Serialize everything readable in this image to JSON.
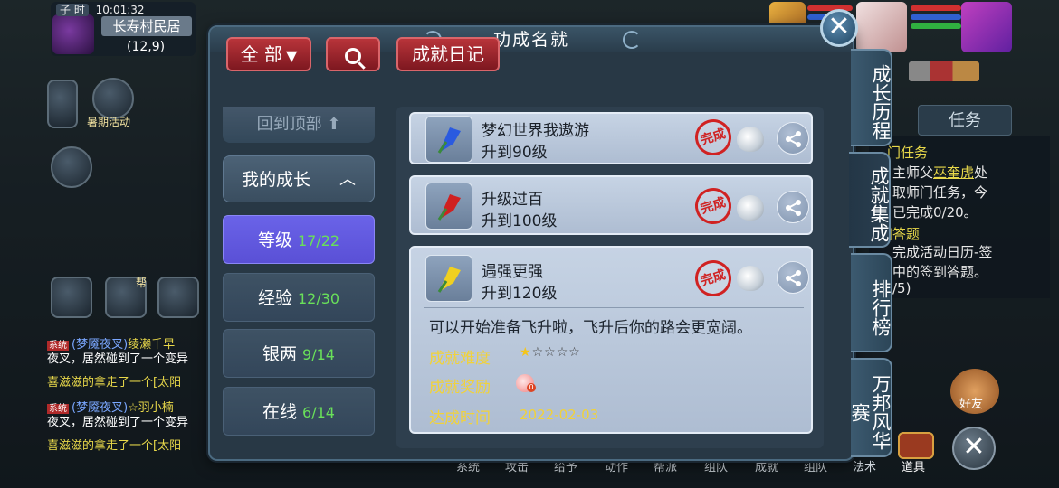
{
  "hud": {
    "shichen": "子 时",
    "clock": "10:01:32",
    "location": "长寿村民居",
    "coords": "(12,9)",
    "summer_event": "暑期活动",
    "gang_label": "帮",
    "quest_tab": "任务",
    "quest_lines": [
      {
        "text_prefix": "门任务",
        "text": ""
      },
      {
        "text_prefix": "主师父",
        "highlight": "巫奎虎",
        "text": "处"
      },
      {
        "text_prefix": "取师门任务，今",
        "highlight": "",
        "text": ""
      },
      {
        "text_prefix": "已完成0/20。",
        "highlight": "",
        "text": ""
      },
      {
        "text_prefix": "]答题",
        "highlight": "",
        "text": ""
      },
      {
        "text_prefix": "完成活动日历-签",
        "highlight": "",
        "text": ""
      },
      {
        "text_prefix": "中的签到答题。",
        "highlight": "",
        "text": ""
      },
      {
        "text_prefix": "/5)",
        "highlight": "",
        "text": ""
      }
    ],
    "chat": [
      {
        "tag": "系统",
        "name": "(梦魇夜叉)",
        "text": "绫濑千早"
      },
      {
        "tag": "",
        "name": "",
        "text": "夜叉，居然碰到了一个变异"
      },
      {
        "tag": "",
        "name": "",
        "text": "喜滋滋的拿走了一个[太阳"
      },
      {
        "tag": "系统",
        "name": "(梦魇夜叉)",
        "text": "☆羽小楠"
      },
      {
        "tag": "",
        "name": "",
        "text": "夜叉，居然碰到了一个变异"
      },
      {
        "tag": "",
        "name": "",
        "text": "喜滋滋的拿走了一个[太阳"
      }
    ],
    "bottom_menu": [
      "系统",
      "攻击",
      "给予",
      "动作",
      "帮派",
      "组队",
      "成就",
      "组队",
      "法术"
    ],
    "friends": "好友",
    "items": "道具"
  },
  "dialog": {
    "title": "功成名就",
    "filter_label": "全 部",
    "diary_label": "成就日记",
    "back_to_top": "回到顶部 ⬆",
    "category_header": "我的成长",
    "categories": [
      {
        "label": "等级",
        "count": "17/22"
      },
      {
        "label": "经验",
        "count": "12/30"
      },
      {
        "label": "银两",
        "count": "9/14"
      },
      {
        "label": "在线",
        "count": "6/14"
      }
    ],
    "achievements": [
      {
        "name": "梦幻世界我遨游",
        "desc": "升到90级",
        "seal": "完成"
      },
      {
        "name": "升级过百",
        "desc": "升到100级",
        "seal": "完成"
      },
      {
        "name": "遇强更强",
        "desc": "升到120级",
        "seal": "完成"
      }
    ],
    "detail": {
      "description": "可以开始准备飞升啦，飞升后你的路会更宽阔。",
      "difficulty_label": "成就难度",
      "difficulty_stars": 1,
      "difficulty_max": 5,
      "reward_label": "成就奖励",
      "reward_badge": "0",
      "date_label": "达成时间",
      "date_value": "2022-02-03"
    },
    "side_tabs": [
      "成长历程",
      "成就集成",
      "排行榜",
      "万邦风华赛"
    ]
  },
  "colors": {
    "active_category": "#5a50d6",
    "count_green": "#69e05a",
    "detail_yellow": "#f1d23a",
    "seal_red": "#d02222"
  }
}
